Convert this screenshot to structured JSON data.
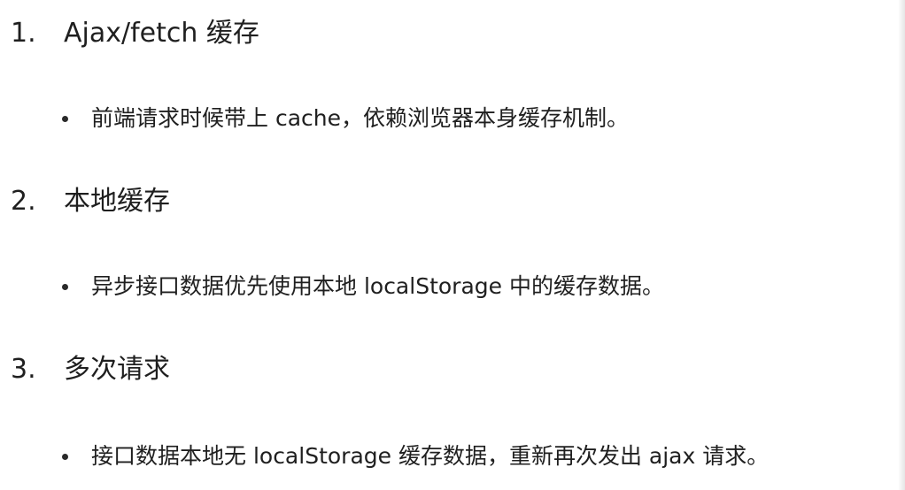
{
  "sections": [
    {
      "number": "1.",
      "title": "Ajax/fetch 缓存",
      "bullet": "前端请求时候带上 cache，依赖浏览器本身缓存机制。"
    },
    {
      "number": "2.",
      "title": "本地缓存",
      "bullet": "异步接口数据优先使用本地 localStorage 中的缓存数据。"
    },
    {
      "number": "3.",
      "title": "多次请求",
      "bullet": "接口数据本地无 localStorage 缓存数据，重新再次发出 ajax 请求。"
    }
  ]
}
